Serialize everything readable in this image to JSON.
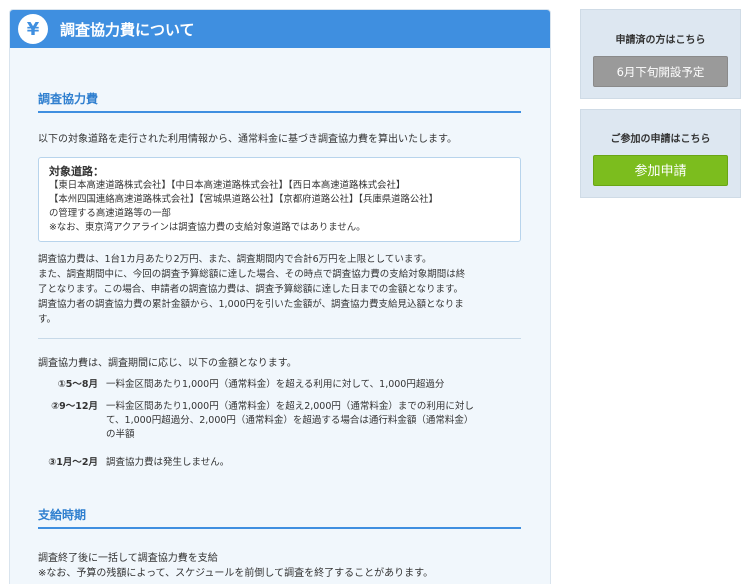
{
  "header": {
    "icon_glyph": "¥",
    "title": "調査協力費について"
  },
  "section1": {
    "heading": "調査協力費",
    "intro": "以下の対象道路を走行された利用情報から、通常料金に基づき調査協力費を算出いたします。",
    "road_box": {
      "title": "対象道路：",
      "lines": [
        "【東日本高速道路株式会社】【中日本高速道路株式会社】【西日本高速道路株式会社】",
        "【本州四国連絡高速道路株式会社】【宮城県道路公社】【京都府道路公社】【兵庫県道路公社】",
        "の管理する高速道路等の一部",
        "※なお、東京湾アクアラインは調査協力費の支給対象道路ではありません。"
      ]
    },
    "paragraph_lines": [
      "調査協力費は、1台1カ月あたり2万円、また、調査期間内で合計6万円を上限としています。",
      "また、調査期間中に、今回の調査予算総額に達した場合、その時点で調査協力費の支給対象期間は終",
      "了となります。この場合、申請者の調査協力費は、調査予算総額に達した日までの金額となります。",
      "調査協力者の調査協力費の累計金額から、1,000円を引いた金額が、調査協力費支給見込額となりま",
      "す。"
    ],
    "amount_intro": "調査協力費は、調査期間に応じ、以下の金額となります。",
    "tiers": [
      {
        "label": "①5〜8月",
        "lines": [
          "一料金区間あたり1,000円（通常料金）を超える利用に対して、1,000円超過分"
        ]
      },
      {
        "label": "②9〜12月",
        "lines": [
          "一料金区間あたり1,000円（通常料金）を超え2,000円（通常料金）までの利用に対し",
          "て、1,000円超過分、2,000円（通常料金）を超過する場合は通行料金額（通常料金）",
          "の半額"
        ]
      },
      {
        "label": "③1月〜2月",
        "lines": [
          "調査協力費は発生しません。"
        ]
      }
    ]
  },
  "section2": {
    "heading": "支給時期",
    "lines": [
      "調査終了後に一括して調査協力費を支給",
      "※なお、予算の残額によって、スケジュールを前倒して調査を終了することがあります。"
    ]
  },
  "side": {
    "box1": {
      "label": "申請済の方はこちら",
      "button": "6月下旬開設予定"
    },
    "box2": {
      "label": "ご参加の申請はこちら",
      "button": "参加申請"
    }
  },
  "colors": {
    "accent": "#3f8fe0",
    "button_gray": "#9a9a9a",
    "button_green": "#7cbd1e",
    "panel_bg": "#f1f7fc"
  }
}
